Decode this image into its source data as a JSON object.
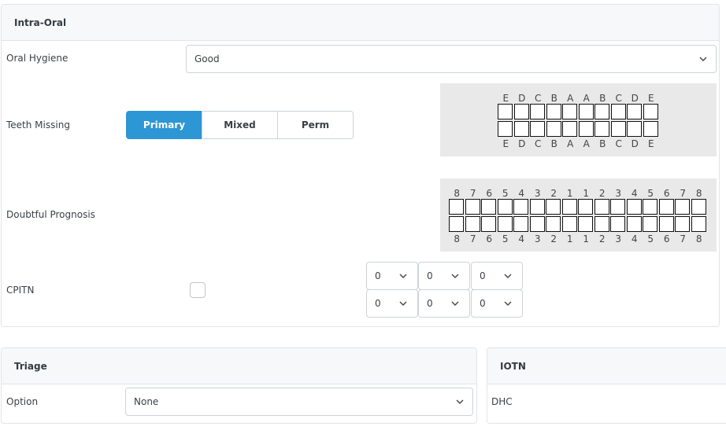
{
  "intra_oral": {
    "title": "Intra-Oral",
    "oral_hygiene": {
      "label": "Oral Hygiene",
      "value": "Good"
    },
    "teeth_missing": {
      "label": "Teeth Missing",
      "options": [
        "Primary",
        "Mixed",
        "Perm"
      ],
      "selected": "Primary",
      "primary_labels": [
        "E",
        "D",
        "C",
        "B",
        "A",
        "A",
        "B",
        "C",
        "D",
        "E"
      ]
    },
    "doubtful_prognosis": {
      "label": "Doubtful Prognosis",
      "perm_labels": [
        "8",
        "7",
        "6",
        "5",
        "4",
        "3",
        "2",
        "1",
        "1",
        "2",
        "3",
        "4",
        "5",
        "6",
        "7",
        "8"
      ]
    },
    "cpitn": {
      "label": "CPITN",
      "values": [
        "0",
        "0",
        "0",
        "0",
        "0",
        "0"
      ]
    }
  },
  "triage": {
    "title": "Triage",
    "option": {
      "label": "Option",
      "value": "None"
    }
  },
  "iotn": {
    "title": "IOTN",
    "dhc_label": "DHC"
  },
  "colors": {
    "accent": "#2d96d5",
    "header_bg": "#f7f8fa",
    "chart_bg": "#e9e9e9"
  }
}
